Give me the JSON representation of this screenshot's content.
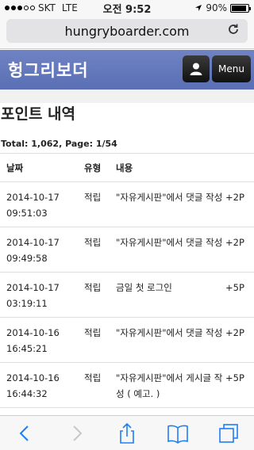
{
  "status": {
    "carrier": "SKT",
    "network": "LTE",
    "time": "오전 9:52",
    "battery": "90%",
    "battery_level": 0.9
  },
  "browser": {
    "url": "hungryboarder.com"
  },
  "site": {
    "logo": "헝그리보더",
    "menu_label": "Menu"
  },
  "page": {
    "title": "포인트 내역",
    "summary": "Total: 1,062, Page: 1/54"
  },
  "table": {
    "headers": {
      "date": "날짜",
      "type": "유형",
      "content": "내용",
      "points": ""
    },
    "rows": [
      {
        "date": "2014-10-17",
        "time": "09:51:03",
        "type": "적립",
        "content": "\"자유게시판\"에서 댓글 작성",
        "points": "+2P"
      },
      {
        "date": "2014-10-17",
        "time": "09:49:58",
        "type": "적립",
        "content": "\"자유게시판\"에서 댓글 작성",
        "points": "+2P"
      },
      {
        "date": "2014-10-17",
        "time": "03:19:11",
        "type": "적립",
        "content": "금일 첫 로그인",
        "points": "+5P"
      },
      {
        "date": "2014-10-16",
        "time": "16:45:21",
        "type": "적립",
        "content": "\"자유게시판\"에서 댓글 작성",
        "points": "+2P"
      },
      {
        "date": "2014-10-16",
        "time": "16:44:32",
        "type": "적립",
        "content": "\"자유게시판\"에서 게시글 작성 ( 예고. )",
        "points": "+5P"
      }
    ]
  },
  "icons": {
    "back": "chevron-left-icon",
    "forward": "chevron-right-icon",
    "share": "share-icon",
    "bookmarks": "book-icon",
    "tabs": "tabs-icon",
    "reload": "reload-icon",
    "user": "user-icon"
  },
  "colors": {
    "accent": "#1e7ef5",
    "header": "#5f74ba"
  }
}
